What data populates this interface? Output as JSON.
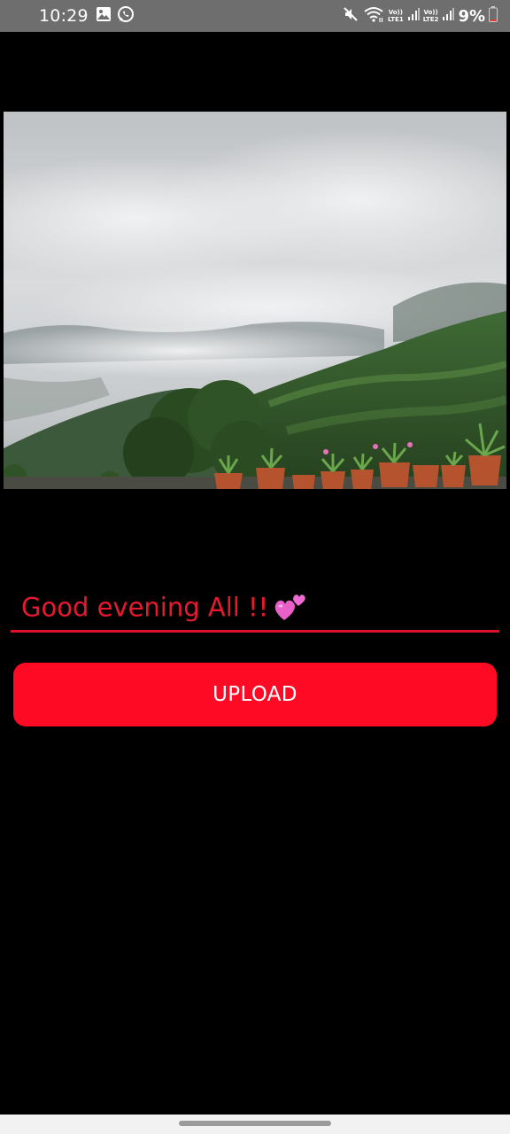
{
  "status_bar": {
    "time": "10:29",
    "left_icons": [
      "gallery-icon",
      "whatsapp-icon"
    ],
    "right_icons": [
      "mute-icon",
      "wifi-icon",
      "signal-icon",
      "signal-icon"
    ],
    "sim1_top": "Vo))",
    "sim1_bottom": "LTE1",
    "sim2_top": "Vo))",
    "sim2_bottom": "LTE2",
    "battery": "9%"
  },
  "photo": {
    "subject": "cloudy mountain landscape with potted plants"
  },
  "caption": {
    "value": "Good evening All !!",
    "color": "#e8182e",
    "underline_color": "#e0102a",
    "emoji": "two-hearts-icon"
  },
  "upload_button": {
    "label": "UPLOAD",
    "color": "#ff0a24"
  },
  "nav_bar": {
    "handle": "gesture-handle"
  }
}
